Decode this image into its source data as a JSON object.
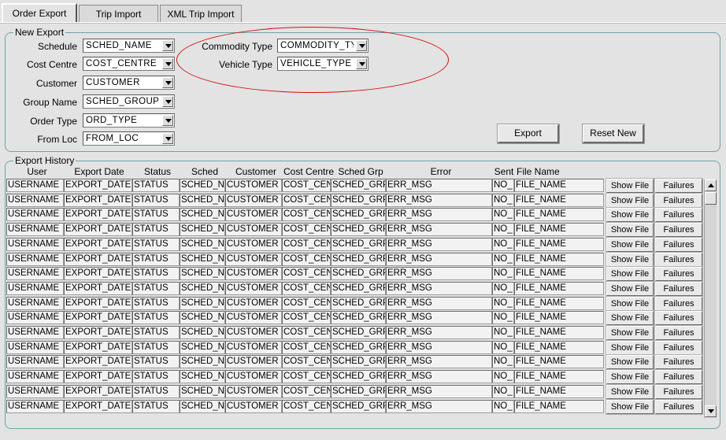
{
  "tabs": [
    "Order Export",
    "Trip Import",
    "XML Trip Import"
  ],
  "new_export": {
    "legend": "New Export",
    "fields": [
      {
        "label": "Schedule",
        "value": "SCHED_NAME"
      },
      {
        "label": "Cost Centre",
        "value": "COST_CENTRE"
      },
      {
        "label": "Customer",
        "value": "CUSTOMER"
      },
      {
        "label": "Group Name",
        "value": "SCHED_GROUP"
      },
      {
        "label": "Order Type",
        "value": "ORD_TYPE"
      },
      {
        "label": "From Loc",
        "value": "FROM_LOC"
      }
    ],
    "commodity": {
      "label": "Commodity Type",
      "value": "COMMODITY_TYPE"
    },
    "vehicle": {
      "label": "Vehicle Type",
      "value": "VEHICLE_TYPE"
    },
    "export_button": "Export",
    "reset_button": "Reset New"
  },
  "history": {
    "legend": "Export History",
    "columns": [
      "User",
      "Export Date",
      "Status",
      "Sched",
      "Customer",
      "Cost Centre",
      "Sched Grp",
      "Error",
      "Sent",
      "File Name"
    ],
    "row_template": [
      "USERNAME",
      "EXPORT_DATE",
      "STATUS",
      "SCHED_NAME",
      "CUSTOMER",
      "COST_CENTRE",
      "SCHED_GRP",
      "ERR_MSG",
      "NO_",
      "FILE_NAME"
    ],
    "row_count": 16,
    "show_file_label": "Show File",
    "failures_label": "Failures"
  },
  "colors": {
    "annotation_ellipse": "#d21010",
    "panel_border": "#6fa3a6",
    "background": "#e3e3e3"
  }
}
